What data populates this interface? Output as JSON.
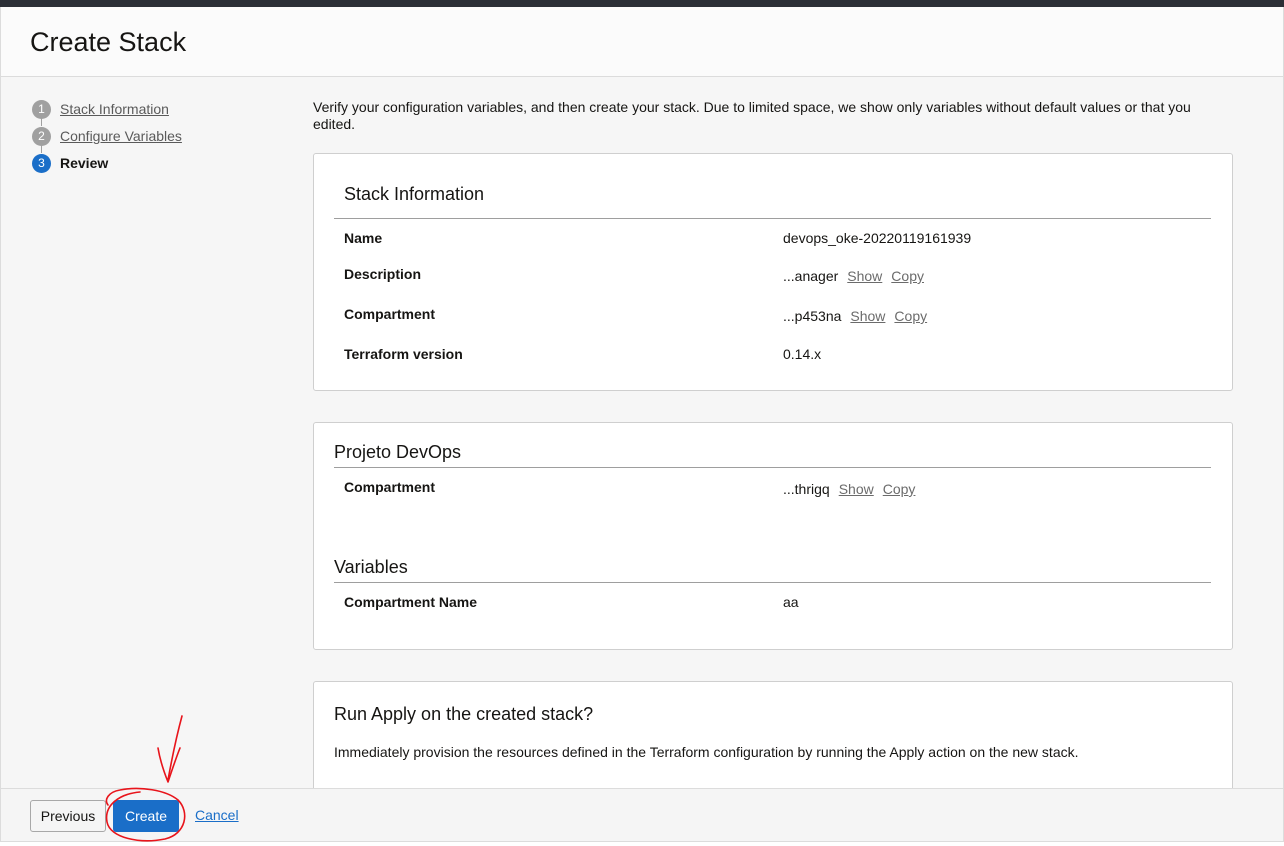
{
  "header": {
    "title": "Create Stack"
  },
  "steps": [
    {
      "number": "1",
      "label": "Stack Information",
      "state": "done"
    },
    {
      "number": "2",
      "label": "Configure Variables",
      "state": "done"
    },
    {
      "number": "3",
      "label": "Review",
      "state": "current"
    }
  ],
  "intro": "Verify your configuration variables, and then create your stack. Due to limited space, we show only variables without default values or that you edited.",
  "stack_info": {
    "title": "Stack Information",
    "rows": [
      {
        "label": "Name",
        "value": "devops_oke-20220119161939"
      },
      {
        "label": "Description",
        "value": "...anager",
        "show": "Show",
        "copy": "Copy"
      },
      {
        "label": "Compartment",
        "value": "...p453na",
        "show": "Show",
        "copy": "Copy"
      },
      {
        "label": "Terraform version",
        "value": "0.14.x"
      }
    ]
  },
  "projeto": {
    "title": "Projeto DevOps",
    "rows": [
      {
        "label": "Compartment",
        "value": "...thrigq",
        "show": "Show",
        "copy": "Copy"
      }
    ]
  },
  "variables": {
    "title": "Variables",
    "rows": [
      {
        "label": "Compartment Name",
        "value": "aa"
      }
    ]
  },
  "run_apply": {
    "title": "Run Apply on the created stack?",
    "description": "Immediately provision the resources defined in the Terraform configuration by running the Apply action on the new stack."
  },
  "footer": {
    "previous_label": "Previous",
    "create_label": "Create",
    "cancel_label": "Cancel"
  },
  "colors": {
    "primary": "#1a6ec8",
    "annotation": "#e8141b"
  }
}
